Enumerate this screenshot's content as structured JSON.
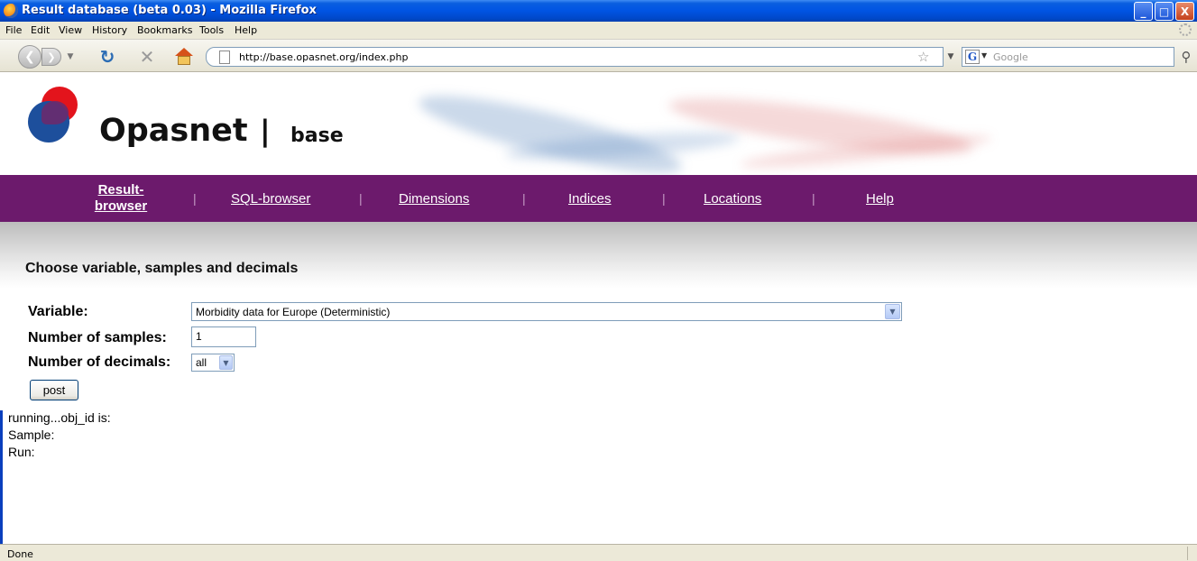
{
  "window": {
    "title": "Result database (beta 0.03) - Mozilla Firefox",
    "minimize_glyph": "_",
    "maximize_glyph": "□",
    "close_glyph": "X"
  },
  "menubar": {
    "items": [
      "File",
      "Edit",
      "View",
      "History",
      "Bookmarks",
      "Tools",
      "Help"
    ]
  },
  "toolbar": {
    "url": "http://base.opasnet.org/index.php",
    "search_placeholder": "Google",
    "search_engine_glyph": "G"
  },
  "banner": {
    "site_name": "Opasnet",
    "separator": "|",
    "subtitle": "base"
  },
  "sitenav": {
    "items": [
      {
        "line1": "Result-",
        "line2": "browser",
        "active": true
      },
      {
        "label": "SQL-browser"
      },
      {
        "label": "Dimensions"
      },
      {
        "label": "Indices"
      },
      {
        "label": "Locations"
      },
      {
        "label": "Help"
      }
    ],
    "separator": "|"
  },
  "form": {
    "heading": "Choose variable, samples and decimals",
    "variable_label": "Variable:",
    "variable_value": "Morbidity data for Europe (Deterministic)",
    "samples_label": "Number of samples:",
    "samples_value": "1",
    "decimals_label": "Number of decimals:",
    "decimals_value": "all",
    "post_label": "post"
  },
  "output": {
    "line1": "running...obj_id is:",
    "line2": "Sample:",
    "line3": "Run:"
  },
  "statusbar": {
    "text": "Done"
  },
  "colors": {
    "nav_purple": "#6c1a6c",
    "logo_red": "#e3141c",
    "logo_blue": "#1d4f9c",
    "xp_titlebar_blue": "#0054e3"
  },
  "icons": [
    "firefox-icon",
    "back-arrow-icon",
    "forward-arrow-icon",
    "reload-icon",
    "stop-icon",
    "home-icon",
    "page-icon",
    "bookmark-star-icon",
    "google-icon",
    "search-magnifier-icon",
    "opasnet-logo-icon",
    "dropdown-arrow-icon"
  ]
}
